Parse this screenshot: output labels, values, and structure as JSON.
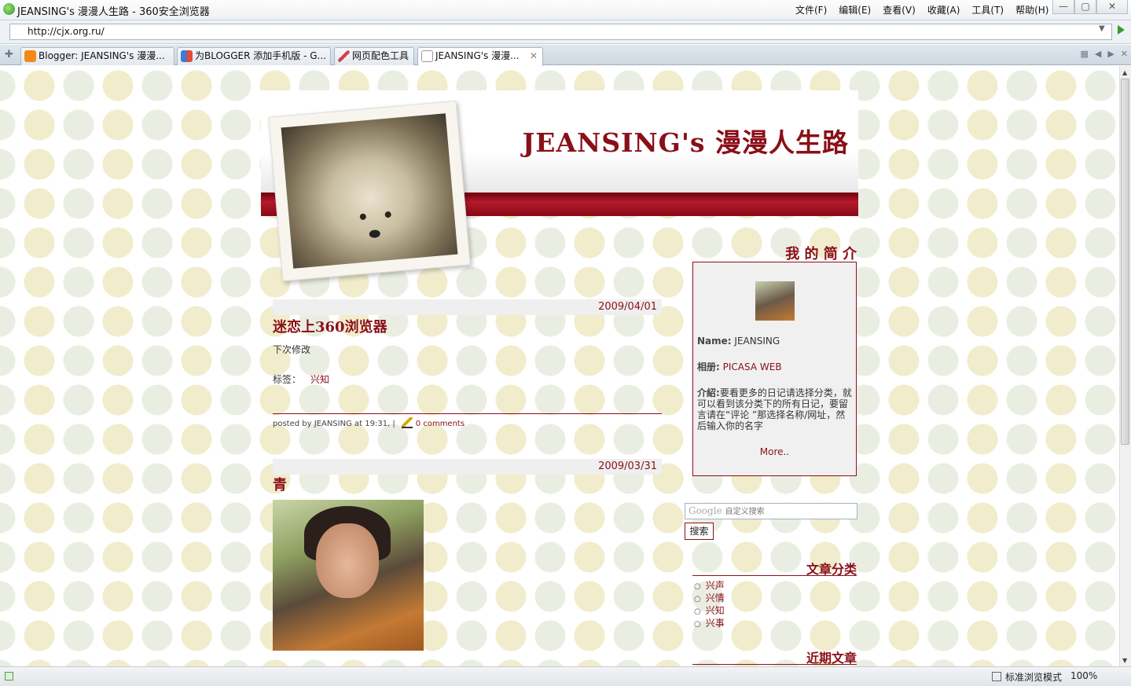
{
  "window": {
    "title": "JEANSING's 漫漫人生路 - 360安全浏览器",
    "menu": [
      "文件(F)",
      "编辑(E)",
      "查看(V)",
      "收藏(A)",
      "工具(T)",
      "帮助(H)"
    ],
    "controls": {
      "minimize": "—",
      "maximize": "▢",
      "close": "✕"
    }
  },
  "address": {
    "url": "http://cjx.org.ru/"
  },
  "tabs": [
    {
      "label": "Blogger: JEANSING's 漫漫...",
      "icon": "blogger-icon",
      "color": "#f28a1a"
    },
    {
      "label": "为BLOGGER 添加手机版 - G...",
      "icon": "google-icon",
      "color": "#3a7bd5"
    },
    {
      "label": "网页配色工具",
      "icon": "pen-icon",
      "color": "#d04040"
    },
    {
      "label": "JEANSING's 漫漫...",
      "icon": "page-icon",
      "color": "#ffffff",
      "active": true
    }
  ],
  "blog": {
    "title": "JEANSING's 漫漫人生路",
    "posts": [
      {
        "date": "2009/04/01",
        "title": "迷恋上360浏览器",
        "body": "下次修改",
        "labels_prefix": "标签：",
        "label": "兴知",
        "footer_text": "posted by JEANSING at 19:31, |",
        "comments": "0 comments"
      },
      {
        "date": "2009/03/31",
        "title": "青"
      }
    ],
    "sidebar": {
      "profile_heading": "我 的 简 介",
      "name_label": "Name:",
      "name_value": "JEANSING",
      "album_label": "相册:",
      "album_value": "PICASA WEB",
      "intro_label": "介紹:",
      "intro_text": "要看更多的日记请选择分类，就可以看到该分类下的所有日记，要留言请在“评论 ”那选择名称/网址，然后输入你的名字",
      "more": "More..",
      "search_logo": "Google",
      "search_placeholder": "自定义搜索",
      "search_button": "搜索",
      "categories_heading": "文章分类",
      "categories": [
        "兴声",
        "兴情",
        "兴知",
        "兴事"
      ],
      "recent_heading": "近期文章"
    }
  },
  "statusbar": {
    "mode": "标准浏览模式",
    "zoom": "100%"
  },
  "colors": {
    "accent": "#8a0f18",
    "band": "#b31a2a"
  }
}
